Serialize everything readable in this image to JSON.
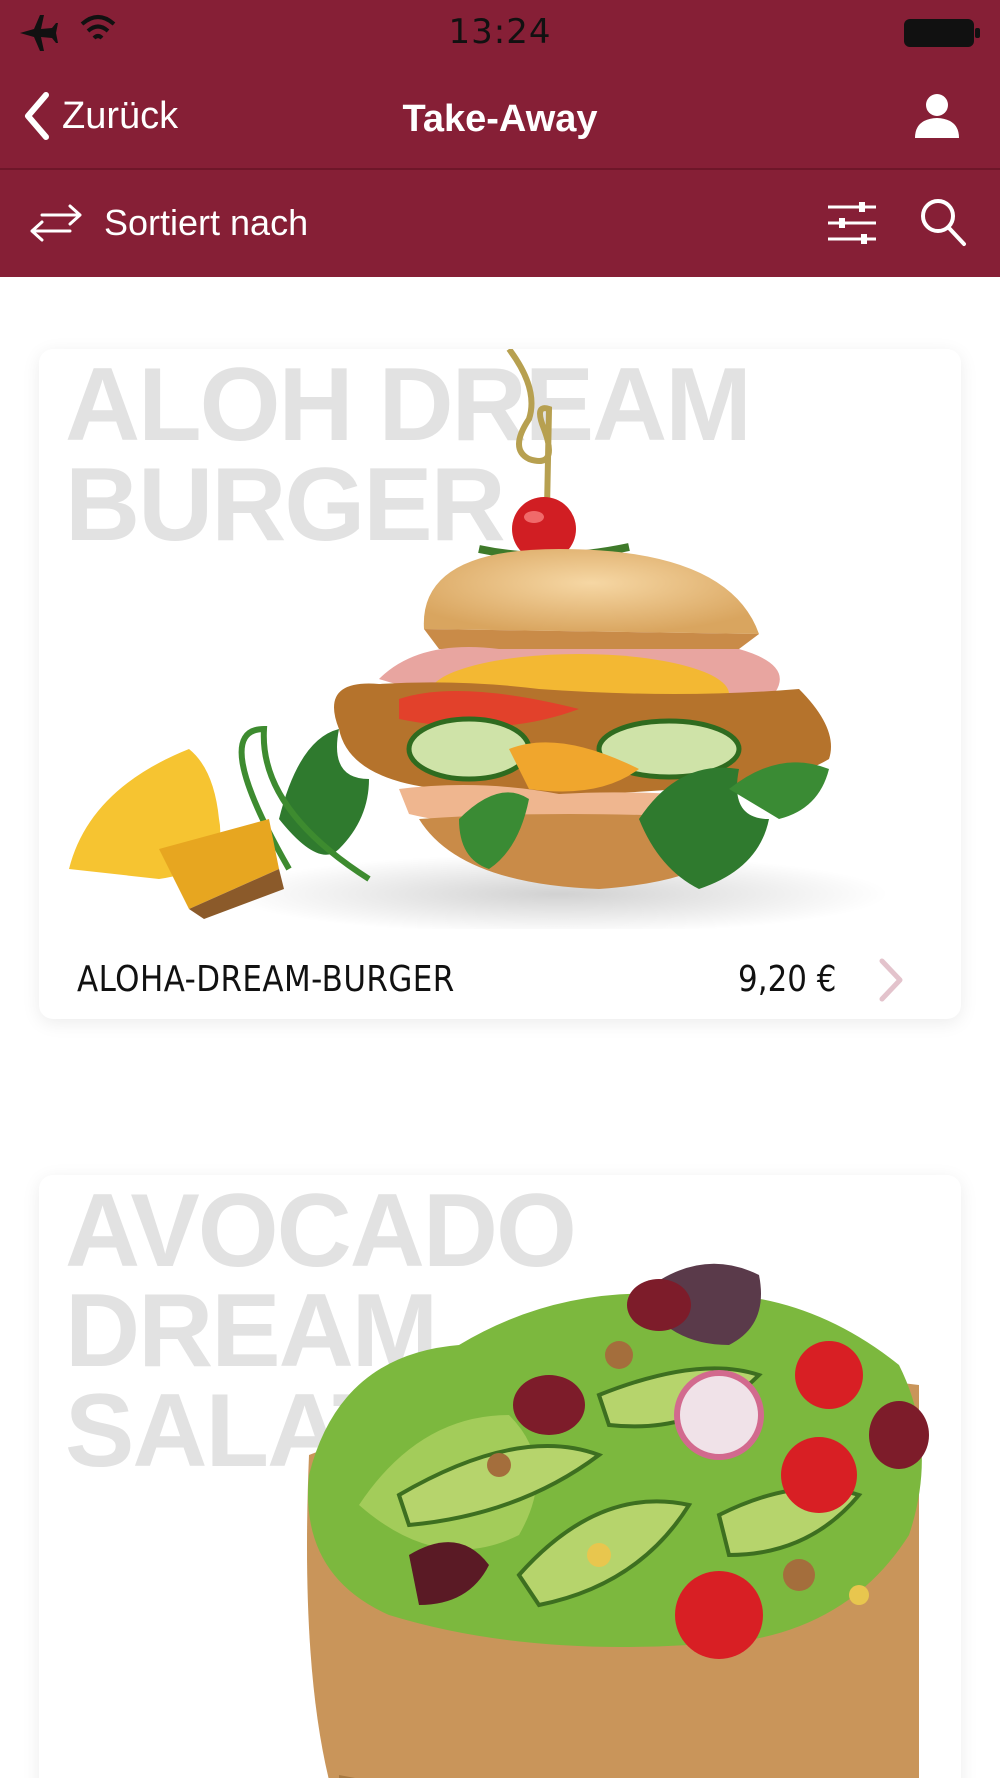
{
  "status_bar": {
    "time": "13:24",
    "icons": [
      "airplane-icon",
      "wifi-icon",
      "battery-icon"
    ]
  },
  "nav": {
    "back_label": "Zurück",
    "title": "Take-Away",
    "icons": [
      "chevron-left-icon",
      "user-icon"
    ]
  },
  "sort_bar": {
    "sort_label": "Sortiert nach",
    "icons": [
      "swap-arrows-icon",
      "sliders-icon",
      "search-icon"
    ]
  },
  "items": [
    {
      "name": "ALOHA-DREAM-BURGER",
      "price": "9,20 €",
      "image_watermark_lines": [
        "ALOH DREAM",
        "BURGER"
      ]
    },
    {
      "name": "",
      "price": "",
      "image_watermark_lines": [
        "AVOCADO",
        "DREAM",
        "SALAT"
      ]
    }
  ],
  "colors": {
    "brand": "#861f36",
    "chevron": "#e3c3cc",
    "watermark": "#e2e2e2"
  }
}
